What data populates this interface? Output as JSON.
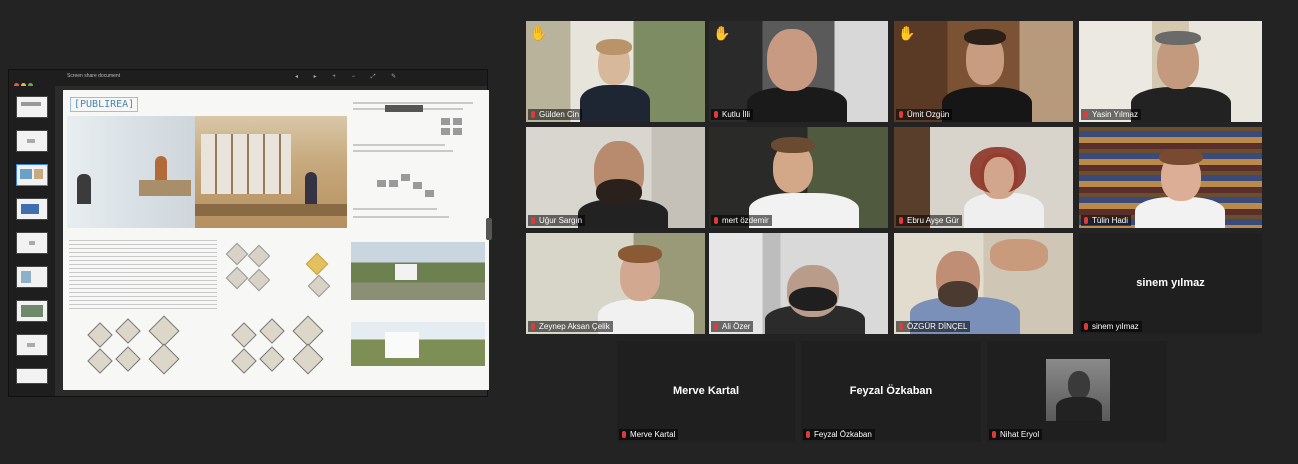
{
  "participants": {
    "gulten": "Gülden Cin",
    "kutlu": "Kutlu İlli",
    "umut": "Ümit Ozgün",
    "yasin": "Yasin Yılmaz",
    "ugur": "Uğur Sargın",
    "mert": "mert özdemir",
    "ebru": "Ebru Ayşe Gür",
    "tulin": "Tülin Hadi",
    "zeynep": "Zeynep Aksan Çelik",
    "ali": "Ali Özer",
    "ozgur": "ÖZGÜR DİNÇEL",
    "sinem_label": "sinem yılmaz",
    "sinem_center": "sinem yılmaz",
    "merve_center": "Merve Kartal",
    "merve_label": "Merve Kartal",
    "feyzal_center": "Feyzal Özkaban",
    "feyzal_label": "Feyzal Özkaban",
    "nihat_label": "Nihat Eryol"
  },
  "share": {
    "brand": "[PUBLIREA]",
    "window_title": "Screen share document"
  },
  "colors": {
    "accent_active": "#e5d36a",
    "mic_muted": "#e03a3a",
    "raise_hand": "#f5c242"
  },
  "icons": [
    "raise-hand-icon",
    "mic-muted-icon"
  ]
}
